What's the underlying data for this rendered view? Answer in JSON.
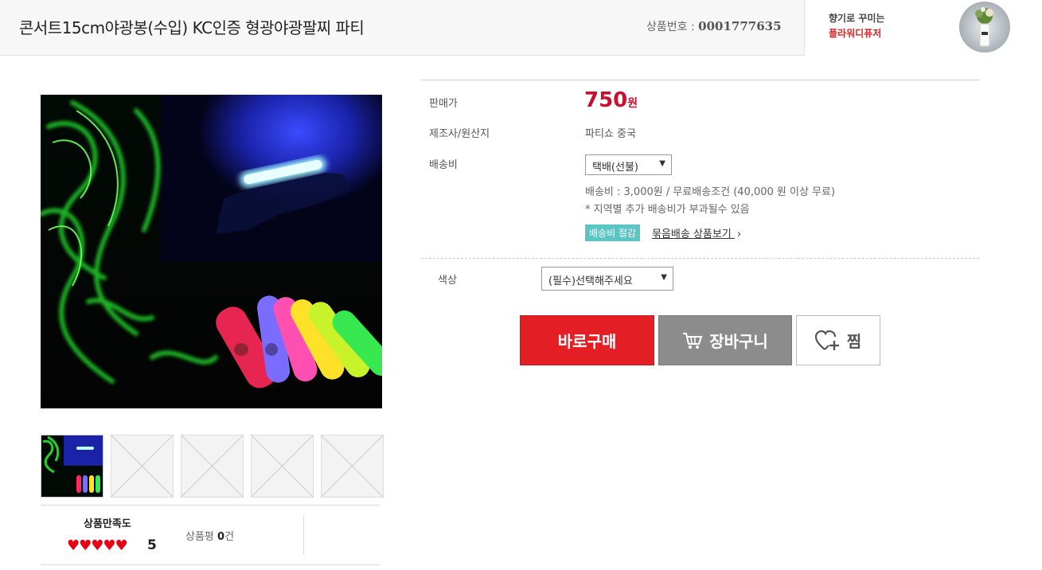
{
  "header": {
    "title": "콘서트15cm야광봉(수입) KC인증 형광야광팔찌 파티",
    "product_no_label": "상품번호 :",
    "product_no": "0001777635",
    "promo_line1": "향기로 꾸미는",
    "promo_line2": "플라워디퓨저"
  },
  "info": {
    "price_label": "판매가",
    "price_value": "750",
    "price_unit": "원",
    "maker_label": "제조사/원산지",
    "maker_value": "파티쇼 중국",
    "shipping_label": "배송비",
    "shipping_select": "택배(선불)",
    "shipping_note": "배송비 : 3,000원 / 무료배송조건 (40,000 원 이상 무료)",
    "shipping_note2": "* 지역별 추가 배송비가 부과될수 있음",
    "badge": "배송비 절감",
    "bundle_link": "묶음배송 상품보기",
    "color_label": "색상",
    "color_select": "(필수)선택해주세요"
  },
  "buttons": {
    "buy": "바로구매",
    "cart": "장바구니",
    "wish": "찜"
  },
  "satisfaction": {
    "title": "상품만족도",
    "hearts": "♥♥♥♥♥",
    "score": "5",
    "review_label": "상품평",
    "review_count": "0",
    "review_unit": "건"
  },
  "colors": {
    "price_red": "#c8102e",
    "buy_red": "#e31e24",
    "cart_gray": "#8c8c8c",
    "badge_teal": "#5bc4c4"
  }
}
